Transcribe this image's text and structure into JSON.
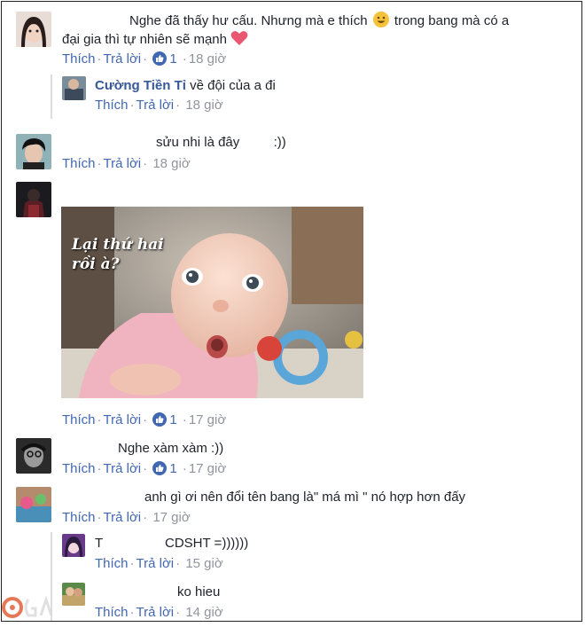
{
  "comments": [
    {
      "text": "Nghe đã thấy hư cấu. Nhưng mà e thích",
      "text_cont": "trong bang mà có a",
      "line2": "đại gia thì tự nhiên sẽ mạnh",
      "like": "Thích",
      "reply": "Trả lời",
      "likes": "1",
      "time": "18 giờ"
    },
    {
      "name": "Cường Tiền Tỉ",
      "text": "về đội của a đi",
      "like": "Thích",
      "reply": "Trả lời",
      "time": "18 giờ"
    },
    {
      "text": "sửu nhi là đây",
      "text_tail": ":))",
      "like": "Thích",
      "reply": "Trả lời",
      "time": "18 giờ"
    },
    {
      "caption_line1": "Lại thứ hai",
      "caption_line2": "rồi à?",
      "like": "Thích",
      "reply": "Trả lời",
      "likes": "1",
      "time": "17 giờ"
    },
    {
      "text": "Nghe xàm xàm :))",
      "like": "Thích",
      "reply": "Trả lời",
      "likes": "1",
      "time": "17 giờ"
    },
    {
      "text": "anh gì ơi nên đổi tên bang là\" má mì \" nó hợp hơn đấy",
      "like": "Thích",
      "reply": "Trả lời",
      "time": "17 giờ"
    },
    {
      "name_initial": "T",
      "text": "CDSHT =))))))",
      "like": "Thích",
      "reply": "Trả lời",
      "time": "15 giờ"
    },
    {
      "text": "ko hieu",
      "like": "Thích",
      "reply": "Trả lời",
      "time": "14 giờ"
    }
  ],
  "colors": {
    "link": "#4267b2",
    "name": "#365899",
    "meta": "#90949c"
  },
  "icons": {
    "like": "thumbs-up-icon",
    "emoji": "grinning-emoji-icon",
    "heart": "heart-icon"
  }
}
